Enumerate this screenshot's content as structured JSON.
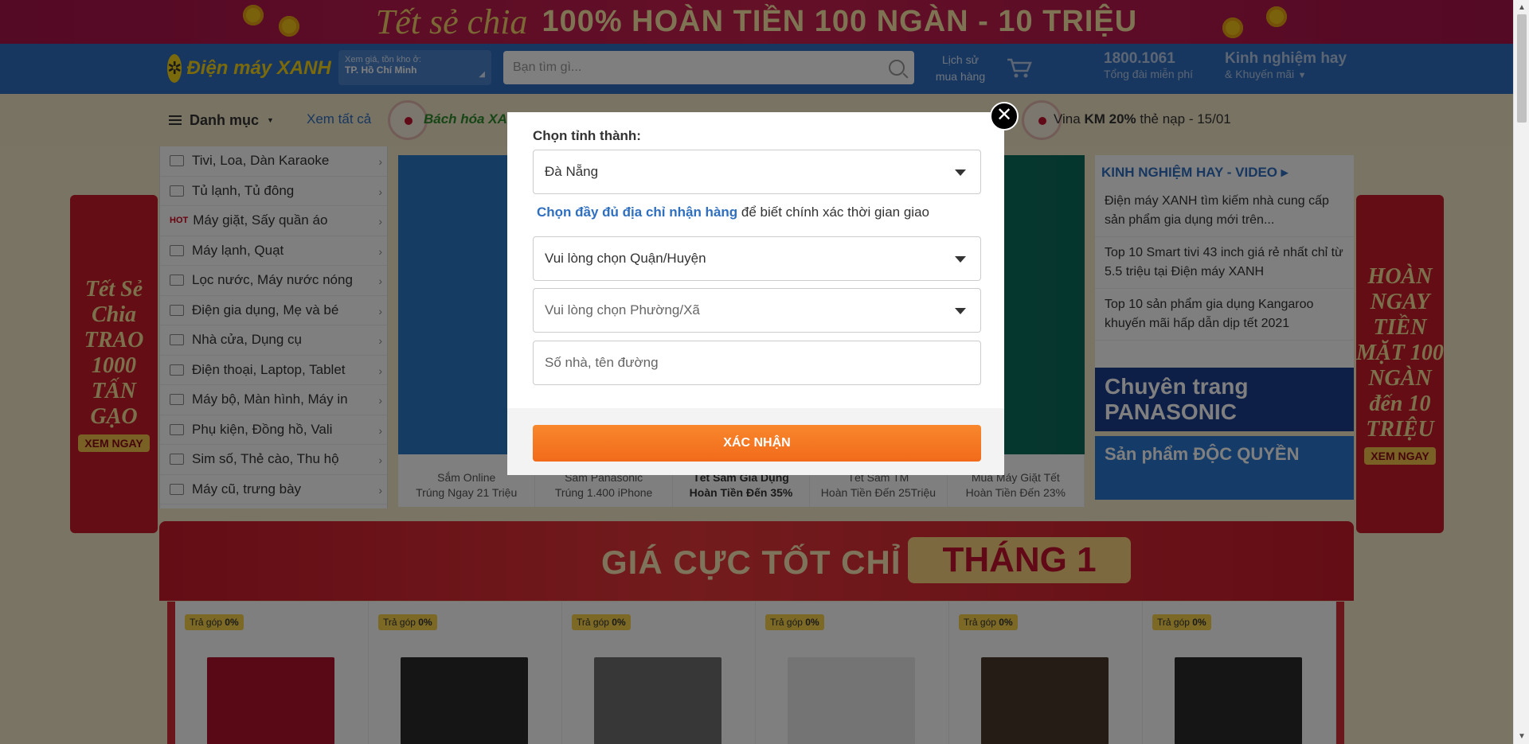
{
  "top_banner": {
    "script": "Tết sẻ chia",
    "headline": "100% HOÀN TIỀN 100 NGÀN - 10 TRIỆU"
  },
  "header": {
    "logo": "Điện máy XANH",
    "location_label": "Xem giá, tồn kho ở:",
    "location_value": "TP. Hồ Chí Minh",
    "search_placeholder": "Bạn tìm gì...",
    "cart_label_1": "Lịch sử",
    "cart_label_2": "mua hàng",
    "hotline_number": "1800.1061",
    "hotline_label": "Tổng đài miễn phí",
    "kinh_title": "Kinh nghiệm hay",
    "kinh_sub": "& Khuyến mãi"
  },
  "nav": {
    "danh_muc": "Danh mục",
    "xem_tat_ca": "Xem tất cả",
    "bach_hoa": "Bách hóa XANH",
    "vina_prefix": "Vina",
    "vina_bold": "KM 20%",
    "vina_suffix": "thẻ nạp - 15/01"
  },
  "side_menu": [
    {
      "label": "Tivi, Loa, Dàn Karaoke",
      "hot": false
    },
    {
      "label": "Tủ lạnh, Tủ đông",
      "hot": false
    },
    {
      "label": "Máy giặt, Sấy quần áo",
      "hot": true
    },
    {
      "label": "Máy lạnh, Quạt",
      "hot": false
    },
    {
      "label": "Lọc nước, Máy nước nóng",
      "hot": false
    },
    {
      "label": "Điện gia dụng, Mẹ và bé",
      "hot": false
    },
    {
      "label": "Nhà cửa, Dụng cụ",
      "hot": false
    },
    {
      "label": "Điện thoại, Laptop, Tablet",
      "hot": false
    },
    {
      "label": "Máy bộ, Màn hình, Máy in",
      "hot": false
    },
    {
      "label": "Phụ kiện, Đồng hồ, Vali",
      "hot": false
    },
    {
      "label": "Sim số, Thẻ cào, Thu hộ",
      "hot": false
    },
    {
      "label": "Máy cũ, trưng bày",
      "hot": false
    }
  ],
  "hot_label": "HOT",
  "slider_captions": [
    {
      "l1": "Sắm Online",
      "l2": "Trúng Ngay 21 Triệu",
      "active": false
    },
    {
      "l1": "Sắm Panasonic",
      "l2": "Trúng 1.400 iPhone",
      "active": false
    },
    {
      "l1": "Tết Sắm Gia Dụng",
      "l2": "Hoàn Tiền Đến 35%",
      "active": true
    },
    {
      "l1": "Tết Sắm TM",
      "l2": "Hoàn Tiền Đến 25Triệu",
      "active": false
    },
    {
      "l1": "Mua Máy Giặt Tết",
      "l2": "Hoàn Tiền Đến 23%",
      "active": false
    }
  ],
  "right_panel": {
    "title": "KINH NGHIỆM HAY - VIDEO",
    "items": [
      "Điện máy XANH tìm kiếm nhà cung cấp sản phẩm gia dụng mới trên...",
      "Top 10 Smart tivi 43 inch giá rẻ nhất chỉ từ 5.5 triệu tại Điện máy XANH",
      "Top 10 sản phẩm gia dụng Kangaroo khuyến mãi hấp dẫn dịp tết 2021"
    ],
    "banner1": "Chuyên trang PANASONIC",
    "banner2": "Sản phẩm ĐỘC QUYỀN"
  },
  "left_side_banner": {
    "text": "Tết Sẻ Chia TRAO 1000 TẤN GẠO",
    "btn": "XEM NGAY"
  },
  "right_side_banner": {
    "text": "HOÀN NGAY TIỀN MẶT 100 NGÀN đến 10 TRIỆU",
    "btn": "XEM NGAY"
  },
  "mid_banner": {
    "text": "GIÁ CỰC TỐT CHỈ CÓ TRONG",
    "month": "THÁNG 1"
  },
  "products": {
    "badge_prefix": "Trả góp",
    "badge_value": "0%",
    "count": 6
  },
  "modal": {
    "label": "Chọn tỉnh thành:",
    "province": "Đà Nẵng",
    "info_link": "Chọn đầy đủ địa chỉ nhận hàng",
    "info_text": " để biết chính xác thời gian giao",
    "district_placeholder": "Vui lòng chọn Quận/Huyện",
    "ward_placeholder": "Vui lòng chọn Phường/Xã",
    "street_placeholder": "Số nhà, tên đường",
    "confirm": "XÁC NHẬN"
  },
  "colors": {
    "brand_blue": "#2f6fc0",
    "accent_orange": "#f26a1b",
    "banner_red": "#c81a2b"
  }
}
